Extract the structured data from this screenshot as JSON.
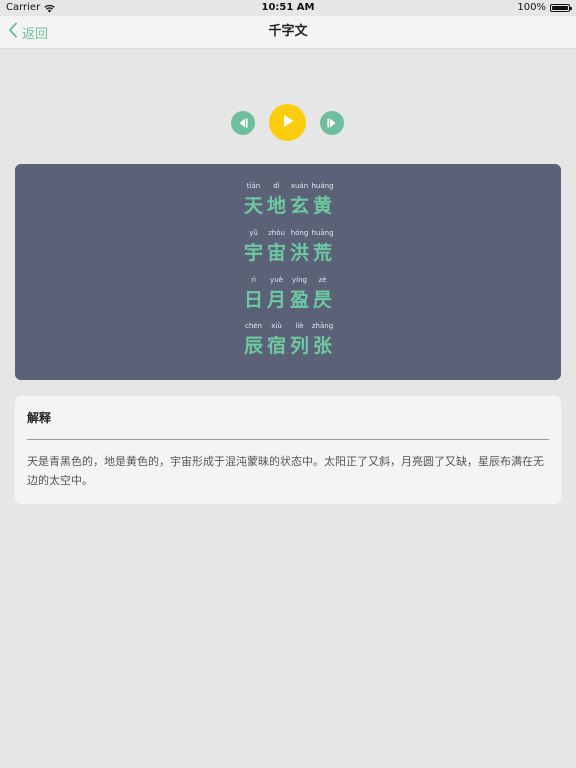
{
  "status_bar": {
    "carrier": "Carrier",
    "time": "10:51 AM",
    "battery": "100%"
  },
  "nav": {
    "back_label": "返回",
    "title": "千字文"
  },
  "player": {
    "prev_icon": "previous-icon",
    "play_icon": "play-icon",
    "next_icon": "next-icon",
    "accent_color": "#6dbf9d",
    "play_color": "#fccd0f"
  },
  "verses": [
    {
      "chars": [
        "天",
        "地",
        "玄",
        "黄"
      ],
      "pinyin": [
        "tiān",
        "dì",
        "xuán",
        "huáng"
      ]
    },
    {
      "chars": [
        "宇",
        "宙",
        "洪",
        "荒"
      ],
      "pinyin": [
        "yǔ",
        "zhòu",
        "hóng",
        "huāng"
      ]
    },
    {
      "chars": [
        "日",
        "月",
        "盈",
        "昃"
      ],
      "pinyin": [
        "rì",
        "yuè",
        "yíng",
        "zè"
      ]
    },
    {
      "chars": [
        "辰",
        "宿",
        "列",
        "张"
      ],
      "pinyin": [
        "chén",
        "xiù",
        "liè",
        "zhāng"
      ]
    }
  ],
  "explanation": {
    "title": "解释",
    "text": "天是青黑色的，地是黄色的，宇宙形成于混沌蒙昧的状态中。太阳正了又斜，月亮圆了又缺，星辰布满在无边的太空中。"
  }
}
